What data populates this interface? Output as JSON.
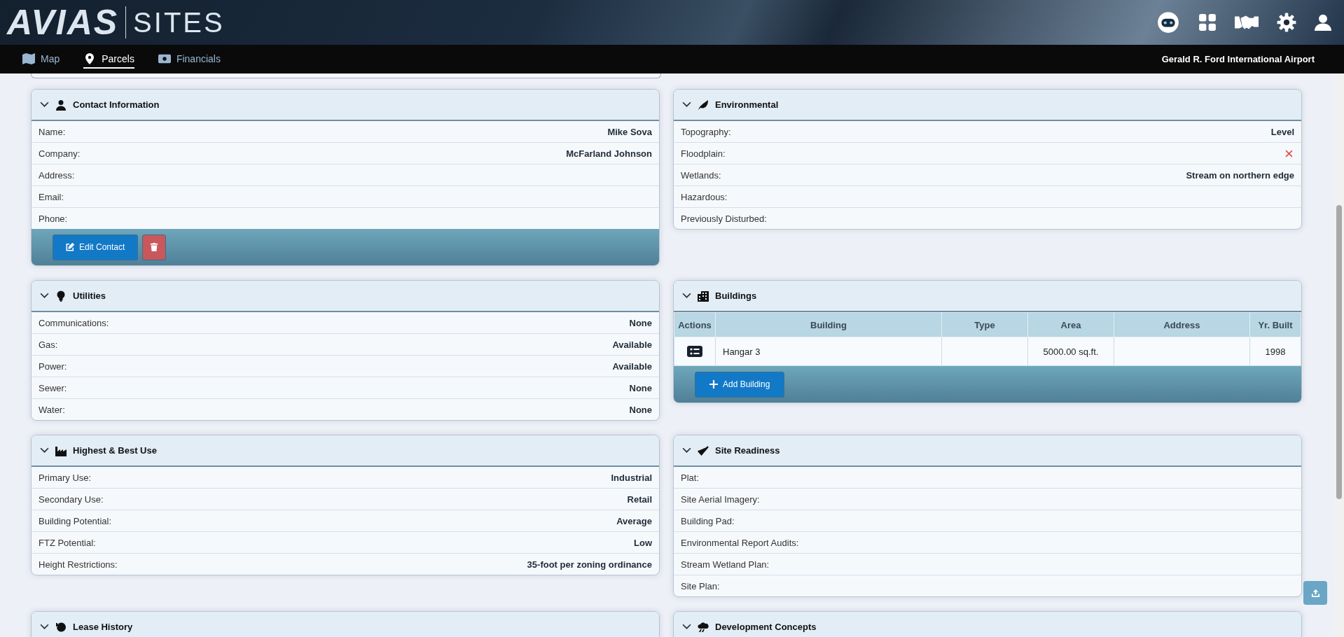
{
  "header": {
    "logo": "AVIAS",
    "product": "SITES"
  },
  "nav": {
    "tabs": [
      {
        "label": "Map",
        "selected": false
      },
      {
        "label": "Parcels",
        "selected": true
      },
      {
        "label": "Financials",
        "selected": false
      }
    ],
    "airport": "Gerald R. Ford International Airport"
  },
  "left": [
    {
      "title": "Contact Information",
      "kind": "details",
      "rows": [
        {
          "label": "Name:",
          "value": "Mike Sova"
        },
        {
          "label": "Company:",
          "value": "McFarland Johnson"
        },
        {
          "label": "Address:"
        },
        {
          "label": "Email:"
        },
        {
          "label": "Phone:"
        }
      ],
      "buttons": [
        {
          "label": "Edit Contact",
          "kind": "edit"
        },
        {
          "kind": "delete"
        }
      ]
    },
    {
      "title": "Utilities",
      "kind": "details",
      "rows": [
        {
          "label": "Communications:",
          "value": "None"
        },
        {
          "label": "Gas:",
          "value": "Available"
        },
        {
          "label": "Power:",
          "value": "Available"
        },
        {
          "label": "Sewer:",
          "value": "None"
        },
        {
          "label": "Water:",
          "value": "None"
        }
      ]
    },
    {
      "title": "Highest & Best Use",
      "kind": "details",
      "rows": [
        {
          "label": "Primary Use:",
          "value": "Industrial"
        },
        {
          "label": "Secondary Use:",
          "value": "Retail"
        },
        {
          "label": "Building Potential:",
          "value": "Average"
        },
        {
          "label": "FTZ Potential:",
          "value": "Low"
        },
        {
          "label": "Height Restrictions:",
          "value": "35-foot per zoning ordinance"
        }
      ]
    },
    {
      "title": "Lease History",
      "kind": "table-cut"
    }
  ],
  "right": [
    {
      "title": "Environmental",
      "kind": "details",
      "rows": [
        {
          "label": "Topography:",
          "value": "Level"
        },
        {
          "label": "Floodplain:",
          "flag": false
        },
        {
          "label": "Wetlands:",
          "value": "Stream on northern edge"
        },
        {
          "label": "Hazardous:"
        },
        {
          "label": "Previously Disturbed:"
        }
      ]
    },
    {
      "title": "Buildings",
      "kind": "table",
      "columns": [
        "Actions",
        "Building",
        "Type",
        "Area",
        "Address",
        "Yr. Built"
      ],
      "rows": [
        [
          "",
          "Hangar 3",
          "",
          "5000.00 sq.ft.",
          "",
          "1998"
        ]
      ],
      "buttons": [
        {
          "label": "Add Building",
          "kind": "add"
        }
      ]
    },
    {
      "title": "Site Readiness",
      "kind": "details",
      "rows": [
        {
          "label": "Plat:"
        },
        {
          "label": "Site Aerial Imagery:"
        },
        {
          "label": "Building Pad:"
        },
        {
          "label": "Environmental Report Audits:"
        },
        {
          "label": "Stream Wetland Plan:"
        },
        {
          "label": "Site Plan:"
        }
      ]
    },
    {
      "title": "Development Concepts",
      "kind": "table-cut"
    }
  ]
}
